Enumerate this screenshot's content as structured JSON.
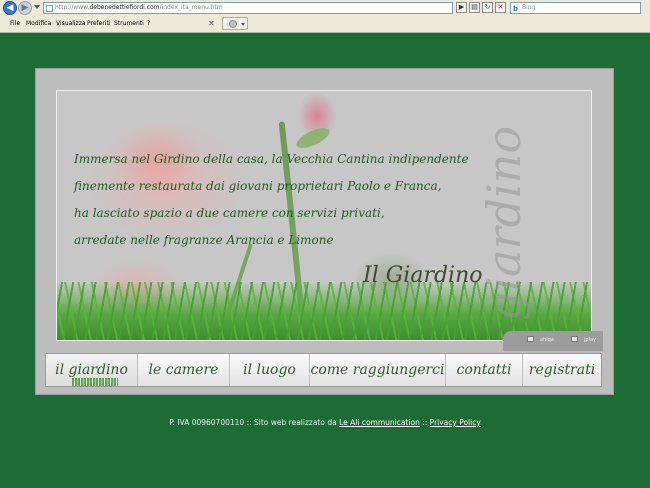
{
  "browser": {
    "address": {
      "prefix": "http://www.",
      "domain": "debenedettiefiordi.com",
      "path": "/index_ita_menu.htm"
    },
    "search_placeholder": "Bing",
    "menu": [
      "File",
      "Modifica",
      "Visualizza",
      "Preferiti",
      "Strumenti",
      "?"
    ]
  },
  "hero": {
    "lines": [
      "Immersa nel Girdino della casa, la Vecchia Cantina indipendente",
      "finemente restaurata dai giovani proprietari Paolo e Franca,",
      "ha lasciato spazio a due camere con servizi privati,",
      "arredate nelle fragranze Arancia e Limone"
    ],
    "section_title": "Il Giardino",
    "watermark": "giardino"
  },
  "languages": [
    {
      "label": "ahiqa"
    },
    {
      "label": "jplay"
    }
  ],
  "nav": [
    {
      "label": "il giardino",
      "active": true
    },
    {
      "label": "le camere"
    },
    {
      "label": "il luogo"
    },
    {
      "label": "come raggiungerci"
    },
    {
      "label": "contatti"
    },
    {
      "label": "registrati"
    }
  ],
  "footer": {
    "piva": "P. IVA 00960700110",
    "sep1": " :: Sito web realizzato da ",
    "agency": "Le Ali communication",
    "sep2": " :: ",
    "privacy": "Privacy Policy"
  },
  "colors": {
    "background": "#1d6b35",
    "text_green": "#2e5d2c"
  }
}
